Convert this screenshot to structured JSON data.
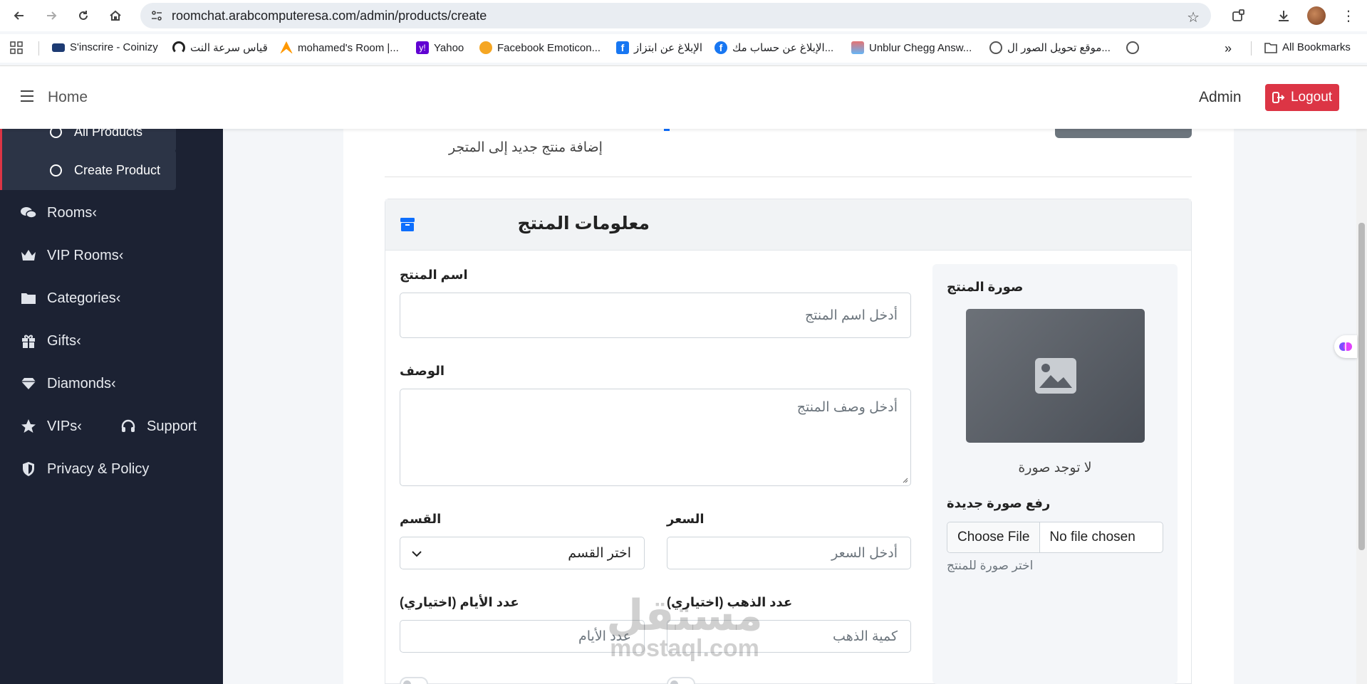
{
  "browser": {
    "url": "roomchat.arabcomputeresa.com/admin/products/create",
    "bookmarks": [
      "S'inscrire - Coinizy",
      "قياس سرعة النت",
      "mohamed's Room |...",
      "Yahoo",
      "Facebook Emoticon...",
      "الإبلاغ عن ابتزاز",
      "الإبلاغ عن حساب مك...",
      "Unblur Chegg Answ...",
      "موقع تحويل الصور ال..."
    ],
    "all_bookmarks": "All Bookmarks"
  },
  "header": {
    "home": "Home",
    "admin": "Admin",
    "logout": "Logout"
  },
  "sidebar": {
    "sub_items": [
      "All Products",
      "Create Product"
    ],
    "items": [
      "Rooms",
      "VIP Rooms",
      "Categories",
      "Gifts",
      "Diamonds",
      "VIPs",
      "Privacy & Policy"
    ],
    "support": "Support",
    "chevron": "‹"
  },
  "page": {
    "subtitle": "إضافة منتج جديد إلى المتجر"
  },
  "form": {
    "section_title": "معلومات المنتج",
    "name_label": "اسم المنتج",
    "name_placeholder": "أدخل اسم المنتج",
    "description_label": "الوصف",
    "description_placeholder": "أدخل وصف المنتج",
    "price_label": "السعر",
    "price_placeholder": "أدخل السعر",
    "category_label": "القسم",
    "category_selected": "اختر القسم",
    "gold_label": "عدد الذهب (اختياري)",
    "gold_placeholder": "كمية الذهب",
    "days_label": "عدد الأيام (اختياري)",
    "days_placeholder": "عدد الأيام"
  },
  "image": {
    "label": "صورة المنتج",
    "no_image": "لا توجد صورة",
    "upload_label": "رفع صورة جديدة",
    "choose_file": "Choose File",
    "no_file": "No file chosen",
    "help": "اختر صورة للمنتج"
  },
  "watermark": {
    "main": "مستقل",
    "sub": "mostaql.com"
  },
  "colors": {
    "sidebar_bg": "#1c2233",
    "accent_red": "#dc3545",
    "primary_blue": "#0d6efd"
  }
}
